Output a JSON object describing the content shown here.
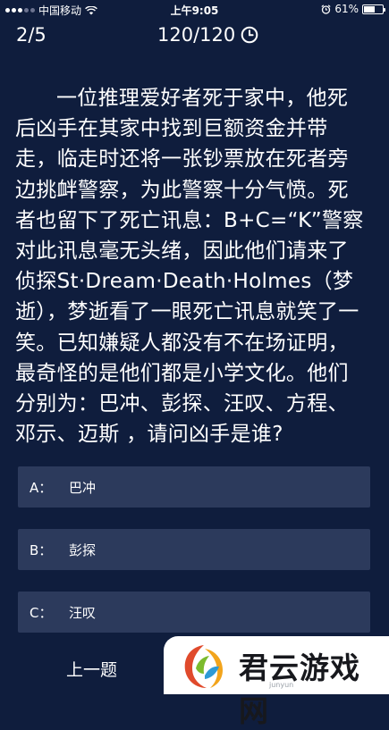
{
  "status_bar": {
    "carrier": "中国移动",
    "time": "上午9:05",
    "battery_percent": "61%",
    "battery_level": 0.61
  },
  "header": {
    "progress": "2/5",
    "timer": "120/120"
  },
  "question": {
    "text": "一位推理爱好者死于家中，他死后凶手在其家中找到巨额资金并带走，临走时还将一张钞票放在死者旁边挑衅警察，为此警察十分气愤。死者也留下了死亡讯息：B+C=“K”警察对此讯息毫无头绪，因此他们请来了侦探St·Dream·Death·Holmes（梦逝），梦逝看了一眼死亡讯息就笑了一笑。已知嫌疑人都没有不在场证明，最奇怪的是他们都是小学文化。他们分别为：巴冲、彭探、汪叹、方程、邓示、迈斯 ，请问凶手是谁?"
  },
  "options": [
    {
      "letter": "A：",
      "text": "巴冲"
    },
    {
      "letter": "B：",
      "text": "彭探"
    },
    {
      "letter": "C：",
      "text": "汪叹"
    }
  ],
  "bottom": {
    "prev_label": "上一题"
  },
  "watermark": {
    "text": "君云游戏网",
    "sub": "junyun"
  },
  "colors": {
    "background": "#0f1d3d",
    "option_bg": "#2c3a5c",
    "text": "#ffffff"
  }
}
